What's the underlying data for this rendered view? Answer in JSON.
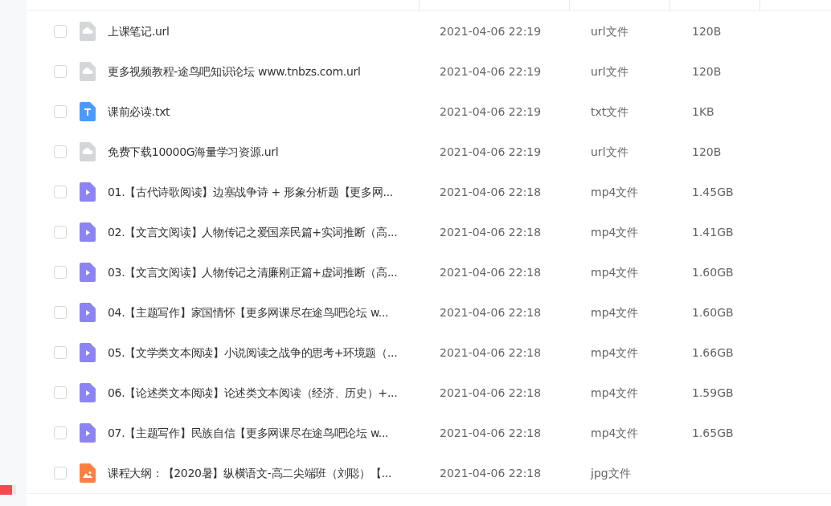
{
  "files": [
    {
      "name": "上课笔记.url",
      "modified": "2021-04-06 22:19",
      "type": "url文件",
      "size": "120B",
      "kind": "link",
      "checked": false
    },
    {
      "name": "更多视频教程-途鸟吧知识论坛 www.tnbzs.com.url",
      "modified": "2021-04-06 22:19",
      "type": "url文件",
      "size": "120B",
      "kind": "link",
      "checked": false
    },
    {
      "name": "课前必读.txt",
      "modified": "2021-04-06 22:19",
      "type": "txt文件",
      "size": "1KB",
      "kind": "text",
      "checked": false
    },
    {
      "name": "免费下载10000G海量学习资源.url",
      "modified": "2021-04-06 22:19",
      "type": "url文件",
      "size": "120B",
      "kind": "link",
      "checked": false
    },
    {
      "name": "01.【古代诗歌阅读】边塞战争诗 + 形象分析题【更多网...",
      "modified": "2021-04-06 22:18",
      "type": "mp4文件",
      "size": "1.45GB",
      "kind": "video",
      "checked": false
    },
    {
      "name": "02.【文言文阅读】人物传记之爱国亲民篇+实词推断（高...",
      "modified": "2021-04-06 22:18",
      "type": "mp4文件",
      "size": "1.41GB",
      "kind": "video",
      "checked": false
    },
    {
      "name": "03.【文言文阅读】人物传记之清廉刚正篇+虚词推断（高...",
      "modified": "2021-04-06 22:18",
      "type": "mp4文件",
      "size": "1.60GB",
      "kind": "video",
      "checked": false
    },
    {
      "name": "04.【主题写作】家国情怀【更多网课尽在途鸟吧论坛 w...",
      "modified": "2021-04-06 22:18",
      "type": "mp4文件",
      "size": "1.60GB",
      "kind": "video",
      "checked": false
    },
    {
      "name": "05.【文学类文本阅读】小说阅读之战争的思考+环境题（...",
      "modified": "2021-04-06 22:18",
      "type": "mp4文件",
      "size": "1.66GB",
      "kind": "video",
      "checked": false
    },
    {
      "name": "06.【论述类文本阅读】论述类文本阅读（经济、历史）+...",
      "modified": "2021-04-06 22:18",
      "type": "mp4文件",
      "size": "1.59GB",
      "kind": "video",
      "checked": false
    },
    {
      "name": "07.【主题写作】民族自信【更多网课尽在途鸟吧论坛 w...",
      "modified": "2021-04-06 22:18",
      "type": "mp4文件",
      "size": "1.65GB",
      "kind": "video",
      "checked": false
    },
    {
      "name": "课程大纲：【2020暑】纵横语文-高二尖端班（刘聪）【...",
      "modified": "2021-04-06 22:18",
      "type": "jpg文件",
      "kind": "image",
      "checked": false
    }
  ]
}
